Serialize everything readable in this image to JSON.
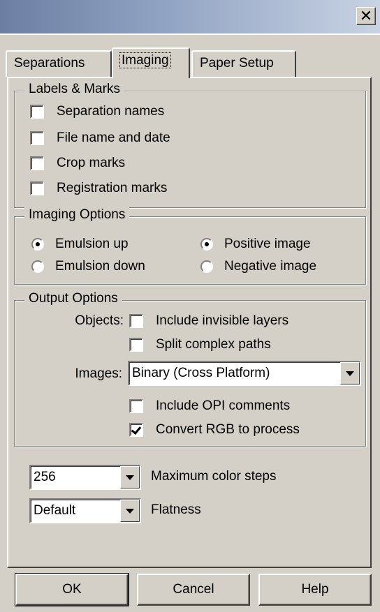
{
  "window": {
    "close_glyph": "✕"
  },
  "tabs": [
    {
      "label": "Separations",
      "mnemonic": "S"
    },
    {
      "label": "Imaging",
      "mnemonic": "I"
    },
    {
      "label": "Paper Setup",
      "mnemonic": "P"
    }
  ],
  "active_tab": "Imaging",
  "labels_marks": {
    "legend": "Labels & Marks",
    "items": [
      {
        "label": "Separation names",
        "checked": false
      },
      {
        "label": "File name and date",
        "checked": false
      },
      {
        "label": "Crop marks",
        "checked": false
      },
      {
        "label": "Registration marks",
        "checked": false
      }
    ]
  },
  "imaging_options": {
    "legend": "Imaging Options",
    "emulsion_up": {
      "label": "Emulsion up",
      "selected": true
    },
    "emulsion_down": {
      "label": "Emulsion down",
      "selected": false
    },
    "positive_image": {
      "label": "Positive image",
      "selected": true
    },
    "negative_image": {
      "label": "Negative image",
      "selected": false
    }
  },
  "output_options": {
    "legend": "Output Options",
    "objects_label": "Objects:",
    "include_invisible_layers": {
      "label": "Include invisible layers",
      "checked": false
    },
    "split_complex_paths": {
      "label": "Split complex paths",
      "checked": false
    },
    "images_label": "Images:",
    "images_value": "Binary (Cross Platform)",
    "include_opi_comments": {
      "label": "Include OPI comments",
      "checked": false
    },
    "convert_rgb": {
      "label": "Convert RGB to process",
      "checked": true
    }
  },
  "color_steps": {
    "value": "256",
    "label": "Maximum color steps"
  },
  "flatness": {
    "value": "Default",
    "label": "Flatness"
  },
  "buttons": {
    "ok": "OK",
    "cancel": "Cancel",
    "help": "Help"
  }
}
